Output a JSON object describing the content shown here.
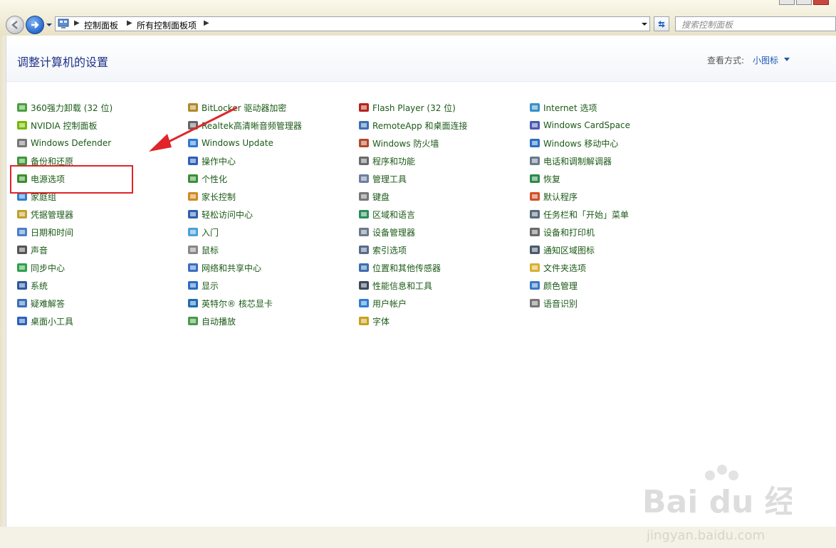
{
  "address": {
    "crumbs": [
      "控制面板",
      "所有控制面板项"
    ],
    "search_placeholder": "搜索控制面板"
  },
  "header": {
    "title": "调整计算机的设置",
    "view_label": "查看方式:",
    "view_value": "小图标"
  },
  "columns": [
    [
      {
        "label": "360强力卸载 (32 位)",
        "icon": "uninstall-icon"
      },
      {
        "label": "NVIDIA 控制面板",
        "icon": "nvidia-icon"
      },
      {
        "label": "Windows Defender",
        "icon": "defender-icon"
      },
      {
        "label": "备份和还原",
        "icon": "backup-icon"
      },
      {
        "label": "电源选项",
        "icon": "power-icon"
      },
      {
        "label": "家庭组",
        "icon": "homegroup-icon"
      },
      {
        "label": "凭据管理器",
        "icon": "credential-icon"
      },
      {
        "label": "日期和时间",
        "icon": "clock-icon"
      },
      {
        "label": "声音",
        "icon": "speaker-icon"
      },
      {
        "label": "同步中心",
        "icon": "sync-icon"
      },
      {
        "label": "系统",
        "icon": "system-icon"
      },
      {
        "label": "疑难解答",
        "icon": "troubleshoot-icon"
      },
      {
        "label": "桌面小工具",
        "icon": "gadget-icon"
      }
    ],
    [
      {
        "label": "BitLocker 驱动器加密",
        "icon": "bitlocker-icon"
      },
      {
        "label": "Realtek高清晰音频管理器",
        "icon": "audio-icon"
      },
      {
        "label": "Windows Update",
        "icon": "update-icon"
      },
      {
        "label": "操作中心",
        "icon": "flag-icon"
      },
      {
        "label": "个性化",
        "icon": "personalize-icon"
      },
      {
        "label": "家长控制",
        "icon": "parental-icon"
      },
      {
        "label": "轻松访问中心",
        "icon": "accessibility-icon"
      },
      {
        "label": "入门",
        "icon": "getting-started-icon"
      },
      {
        "label": "鼠标",
        "icon": "mouse-icon"
      },
      {
        "label": "网络和共享中心",
        "icon": "network-icon"
      },
      {
        "label": "显示",
        "icon": "display-icon"
      },
      {
        "label": "英特尔® 核芯显卡",
        "icon": "intel-icon"
      },
      {
        "label": "自动播放",
        "icon": "autoplay-icon"
      }
    ],
    [
      {
        "label": "Flash Player (32 位)",
        "icon": "flash-icon"
      },
      {
        "label": "RemoteApp 和桌面连接",
        "icon": "remote-icon"
      },
      {
        "label": "Windows 防火墙",
        "icon": "firewall-icon"
      },
      {
        "label": "程序和功能",
        "icon": "programs-icon"
      },
      {
        "label": "管理工具",
        "icon": "admin-tools-icon"
      },
      {
        "label": "键盘",
        "icon": "keyboard-icon"
      },
      {
        "label": "区域和语言",
        "icon": "globe-icon"
      },
      {
        "label": "设备管理器",
        "icon": "device-manager-icon"
      },
      {
        "label": "索引选项",
        "icon": "index-icon"
      },
      {
        "label": "位置和其他传感器",
        "icon": "location-icon"
      },
      {
        "label": "性能信息和工具",
        "icon": "performance-icon"
      },
      {
        "label": "用户帐户",
        "icon": "users-icon"
      },
      {
        "label": "字体",
        "icon": "fonts-icon"
      }
    ],
    [
      {
        "label": "Internet 选项",
        "icon": "internet-icon"
      },
      {
        "label": "Windows CardSpace",
        "icon": "cardspace-icon"
      },
      {
        "label": "Windows 移动中心",
        "icon": "mobility-icon"
      },
      {
        "label": "电话和调制解调器",
        "icon": "phone-icon"
      },
      {
        "label": "恢复",
        "icon": "recovery-icon"
      },
      {
        "label": "默认程序",
        "icon": "default-programs-icon"
      },
      {
        "label": "任务栏和「开始」菜单",
        "icon": "taskbar-icon"
      },
      {
        "label": "设备和打印机",
        "icon": "printer-icon"
      },
      {
        "label": "通知区域图标",
        "icon": "notify-icon"
      },
      {
        "label": "文件夹选项",
        "icon": "folder-icon"
      },
      {
        "label": "颜色管理",
        "icon": "color-icon"
      },
      {
        "label": "语音识别",
        "icon": "microphone-icon"
      }
    ]
  ],
  "watermark": {
    "brand": "Bai du 经验",
    "url": "jingyan.baidu.com"
  },
  "colors": {
    "title": "#1e3287",
    "link": "#1b5a17",
    "highlight": "#e0242a"
  }
}
